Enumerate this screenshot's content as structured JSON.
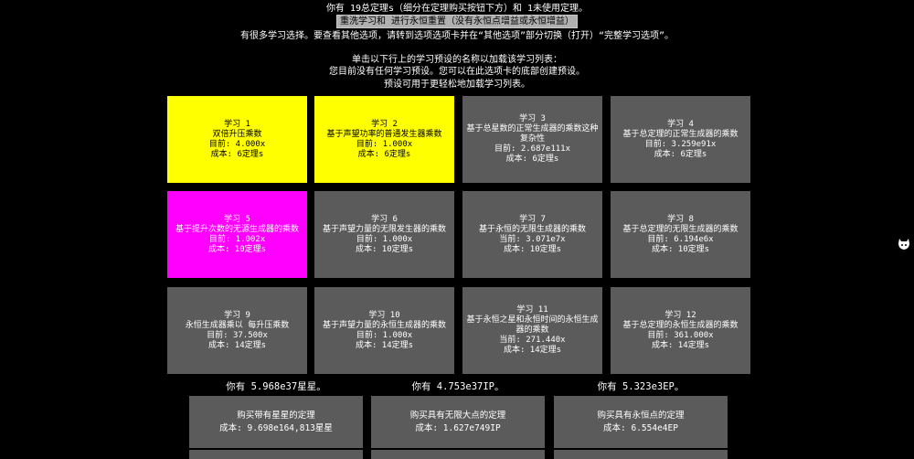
{
  "header": {
    "line1": "你有 19总定理s（细分在定理购买按钮下方）和 1未使用定理。",
    "respec_button": "重洗学习和 进行永恒重置（没有永恒点增益或永恒增益）",
    "line3": "有很多学习选择。要查看其他选项，请转到选项选项卡并在“其他选项”部分切换（打开）“完整学习选项”。",
    "line4": "单击以下行上的学习预设的名称以加载该学习列表：",
    "line5": "您目前没有任何学习预设。您可以在此选项卡的底部创建预设。",
    "line6": "预设可用于更轻松地加载学习列表。"
  },
  "studies": [
    {
      "title": "学习 1",
      "desc": "双倍升压乘数",
      "value_label": "目前:",
      "value": "4.000x",
      "cost": "成本:  6定理s",
      "state": "bought",
      "color": "#ffff00"
    },
    {
      "title": "学习 2",
      "desc": "基于声望功率的普通发生器乘数",
      "value_label": "目前:",
      "value": "1.000x",
      "cost": "成本:  6定理s",
      "state": "bought",
      "color": "#ffff00"
    },
    {
      "title": "学习 3",
      "desc": "基于总星数的正常生成器的乘数这种复杂性",
      "value_label": "目前:",
      "value": "2.687e111x",
      "cost": "成本:  6定理s",
      "state": "locked",
      "color": "#5b5b5b"
    },
    {
      "title": "学习 4",
      "desc": "基于总定理的正常生成器的乘数",
      "value_label": "目前:",
      "value": "3.259e91x",
      "cost": "成本:  6定理s",
      "state": "locked",
      "color": "#5b5b5b"
    },
    {
      "title": "学习 5",
      "desc": "基于提升次数的无源生成器的乘数",
      "value_label": "目前:",
      "value": "1.002x",
      "cost": "成本:  10定理s",
      "state": "available",
      "color": "#ff00ff"
    },
    {
      "title": "学习 6",
      "desc": "基于声望力量的无限发生器的乘数",
      "value_label": "目前:",
      "value": "1.000x",
      "cost": "成本:  10定理s",
      "state": "locked",
      "color": "#5b5b5b"
    },
    {
      "title": "学习 7",
      "desc": "基于永恒的无限生成器的乘数",
      "value_label": "当前:",
      "value": "3.071e7x",
      "cost": "成本:  10定理s",
      "state": "locked",
      "color": "#5b5b5b"
    },
    {
      "title": "学习 8",
      "desc": "基于总定理的无限生成器的乘数",
      "value_label": "目前:",
      "value": "6.194e6x",
      "cost": "成本:  10定理s",
      "state": "locked",
      "color": "#5b5b5b"
    },
    {
      "title": "学习 9",
      "desc": "永恒生成器乘以 每升压乘数",
      "value_label": "目前:",
      "value": "37.500x",
      "cost": "成本:  14定理s",
      "state": "locked",
      "color": "#5b5b5b"
    },
    {
      "title": "学习 10",
      "desc": "基于声望力量的永恒生成器的乘数",
      "value_label": "目前:",
      "value": "1.000x",
      "cost": "成本:  14定理s",
      "state": "locked",
      "color": "#5b5b5b"
    },
    {
      "title": "学习 11",
      "desc": "基于永恒之星和永恒时间的永恒生成器的乘数",
      "value_label": "当前:",
      "value": "271.440x",
      "cost": "成本:  14定理s",
      "state": "locked",
      "color": "#5b5b5b"
    },
    {
      "title": "学习 12",
      "desc": "基于总定理的永恒生成器的乘数",
      "value_label": "目前:",
      "value": "361.000x",
      "cost": "成本:  14定理s",
      "state": "locked",
      "color": "#5b5b5b"
    }
  ],
  "currencies": {
    "stars": "你有 5.968e37星星。",
    "ip": "你有 4.753e37IP。",
    "ep": "你有 5.323e3EP。"
  },
  "theorem_buy": [
    {
      "title": "购买带有星星的定理",
      "cost": "成本:  9.698e164,813星星"
    },
    {
      "title": "购买具有无限大点的定理",
      "cost": "成本:  1.627e749IP"
    },
    {
      "title": "购买具有永恒点的定理",
      "cost": "成本:  6.554e4EP"
    }
  ],
  "side_icon": "github-icon"
}
